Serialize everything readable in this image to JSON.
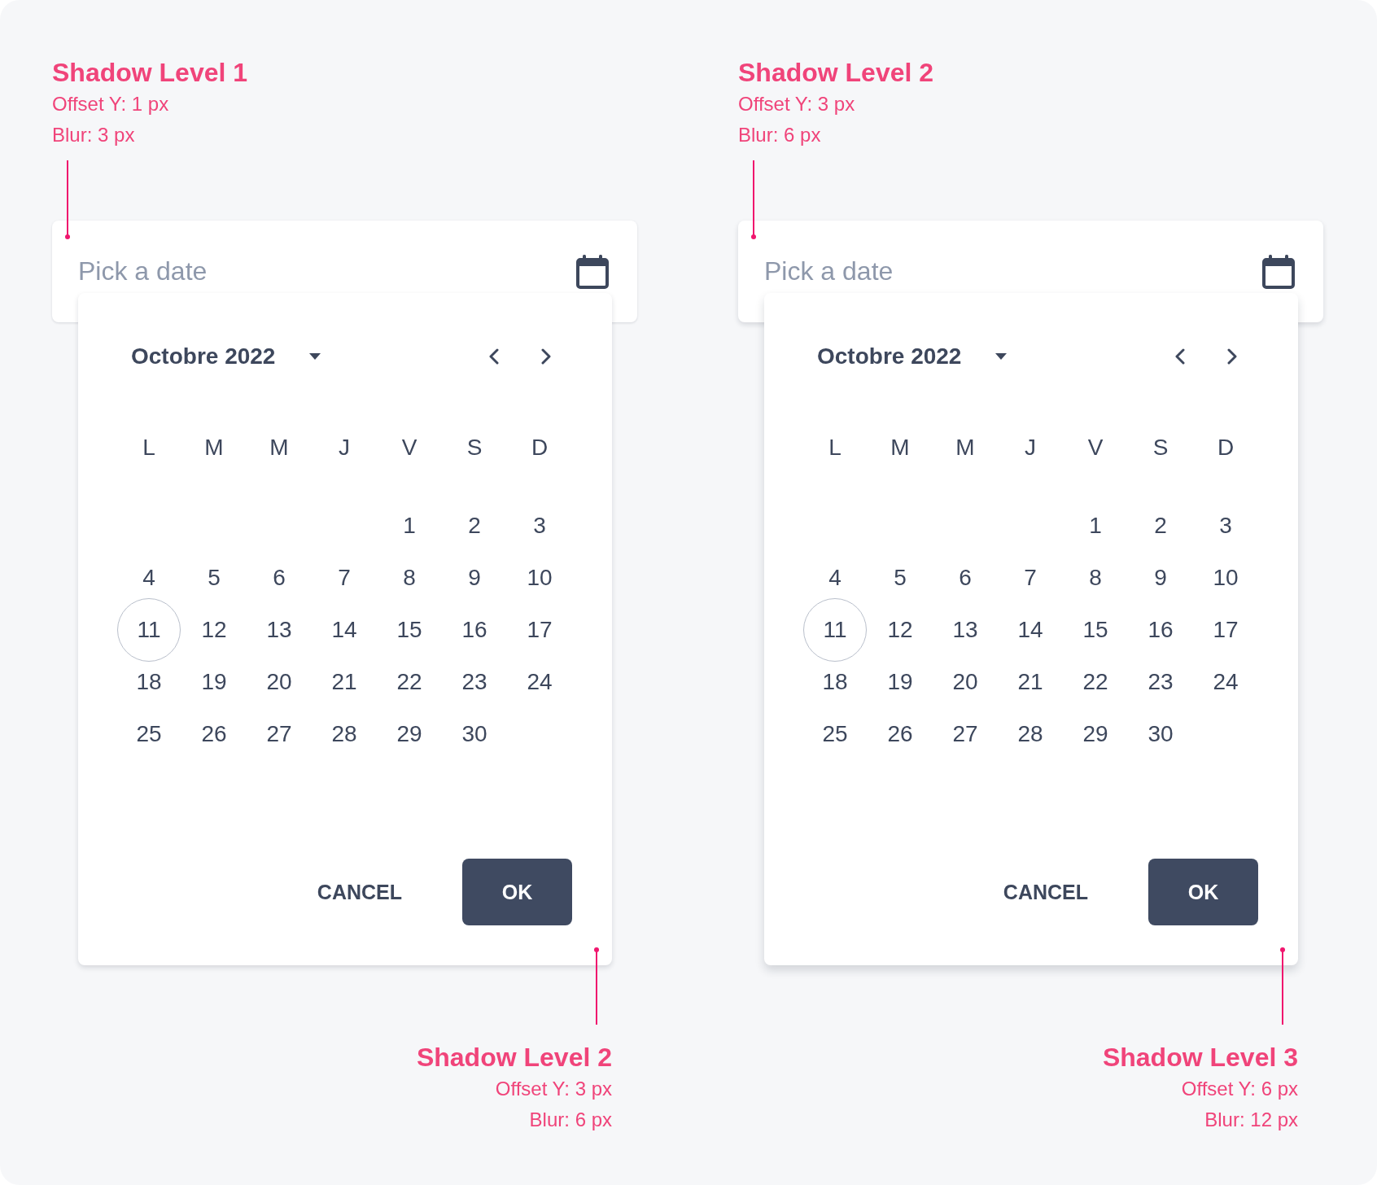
{
  "specimens": [
    {
      "annotation": {
        "title": "Shadow Level 1",
        "offset": "Offset Y: 1 px",
        "blur": "Blur: 3 px"
      },
      "date_field": {
        "placeholder": "Pick a date"
      },
      "calendar": {
        "month": "Octobre 2022",
        "weekdays": [
          "L",
          "M",
          "M",
          "J",
          "V",
          "S",
          "D"
        ],
        "weeks": [
          [
            {
              "day": "1",
              "today": false
            },
            {
              "day": "2",
              "today": false
            },
            {
              "day": "3",
              "today": false
            }
          ],
          [
            {
              "day": "4",
              "today": false
            },
            {
              "day": "5",
              "today": false
            },
            {
              "day": "6",
              "today": false
            },
            {
              "day": "7",
              "today": false
            },
            {
              "day": "8",
              "today": false
            },
            {
              "day": "9",
              "today": false
            },
            {
              "day": "10",
              "today": false
            }
          ],
          [
            {
              "day": "11",
              "today": true
            },
            {
              "day": "12",
              "today": false
            },
            {
              "day": "13",
              "today": false
            },
            {
              "day": "14",
              "today": false
            },
            {
              "day": "15",
              "today": false
            },
            {
              "day": "16",
              "today": false
            },
            {
              "day": "17",
              "today": false
            }
          ],
          [
            {
              "day": "18",
              "today": false
            },
            {
              "day": "19",
              "today": false
            },
            {
              "day": "20",
              "today": false
            },
            {
              "day": "21",
              "today": false
            },
            {
              "day": "22",
              "today": false
            },
            {
              "day": "23",
              "today": false
            },
            {
              "day": "24",
              "today": false
            }
          ],
          [
            {
              "day": "25",
              "today": false
            },
            {
              "day": "26",
              "today": false
            },
            {
              "day": "27",
              "today": false
            },
            {
              "day": "28",
              "today": false
            },
            {
              "day": "29",
              "today": false
            },
            {
              "day": "30",
              "today": false
            }
          ]
        ],
        "buttons": [
          {
            "label": "CANCEL",
            "kind": "text"
          },
          {
            "label": "OK",
            "kind": "filled"
          }
        ]
      },
      "calendar_annotation": {
        "title": "Shadow Level 2",
        "offset": "Offset Y: 3 px",
        "blur": "Blur: 6 px"
      }
    },
    {
      "annotation": {
        "title": "Shadow Level 2",
        "offset": "Offset Y: 3 px",
        "blur": "Blur: 6 px"
      },
      "date_field": {
        "placeholder": "Pick a date"
      },
      "calendar": {
        "month": "Octobre 2022",
        "weekdays": [
          "L",
          "M",
          "M",
          "J",
          "V",
          "S",
          "D"
        ],
        "weeks": [
          [
            {
              "day": "1",
              "today": false
            },
            {
              "day": "2",
              "today": false
            },
            {
              "day": "3",
              "today": false
            }
          ],
          [
            {
              "day": "4",
              "today": false
            },
            {
              "day": "5",
              "today": false
            },
            {
              "day": "6",
              "today": false
            },
            {
              "day": "7",
              "today": false
            },
            {
              "day": "8",
              "today": false
            },
            {
              "day": "9",
              "today": false
            },
            {
              "day": "10",
              "today": false
            }
          ],
          [
            {
              "day": "11",
              "today": true
            },
            {
              "day": "12",
              "today": false
            },
            {
              "day": "13",
              "today": false
            },
            {
              "day": "14",
              "today": false
            },
            {
              "day": "15",
              "today": false
            },
            {
              "day": "16",
              "today": false
            },
            {
              "day": "17",
              "today": false
            }
          ],
          [
            {
              "day": "18",
              "today": false
            },
            {
              "day": "19",
              "today": false
            },
            {
              "day": "20",
              "today": false
            },
            {
              "day": "21",
              "today": false
            },
            {
              "day": "22",
              "today": false
            },
            {
              "day": "23",
              "today": false
            },
            {
              "day": "24",
              "today": false
            }
          ],
          [
            {
              "day": "25",
              "today": false
            },
            {
              "day": "26",
              "today": false
            },
            {
              "day": "27",
              "today": false
            },
            {
              "day": "28",
              "today": false
            },
            {
              "day": "29",
              "today": false
            },
            {
              "day": "30",
              "today": false
            }
          ]
        ],
        "buttons": [
          {
            "label": "CANCEL",
            "kind": "text"
          },
          {
            "label": "OK",
            "kind": "filled"
          }
        ]
      },
      "calendar_annotation": {
        "title": "Shadow Level 3",
        "offset": "Offset Y: 6 px",
        "blur": "Blur: 12 px"
      }
    }
  ]
}
